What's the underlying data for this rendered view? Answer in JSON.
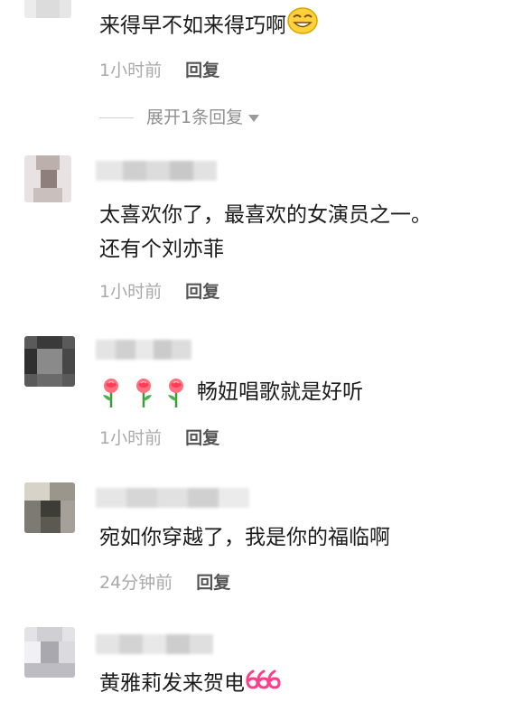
{
  "comments": [
    {
      "text": "来得早不如来得巧啊",
      "time": "1小时前",
      "reply_label": "回复",
      "expand_label": "展开1条回复"
    },
    {
      "line1": "太喜欢你了，最喜欢的女演员之一。",
      "line2": "还有个刘亦菲",
      "time": "1小时前",
      "reply_label": "回复"
    },
    {
      "text": "畅妞唱歌就是好听",
      "emoji_icons": [
        "rose-icon",
        "rose-icon",
        "rose-icon"
      ],
      "time": "1小时前",
      "reply_label": "回复"
    },
    {
      "text": "宛如你穿越了，我是你的福临啊",
      "time": "24分钟前",
      "reply_label": "回复"
    },
    {
      "text": "黄雅莉发来贺电",
      "trailing_icon": "666-sticker-icon"
    }
  ],
  "colors": {
    "comment_text": "#1b1b1b",
    "meta_text": "#a9a9a9",
    "reply_text": "#555555",
    "expand_text": "#8f8f8f",
    "sticker_pink": "#ff3d8b"
  }
}
